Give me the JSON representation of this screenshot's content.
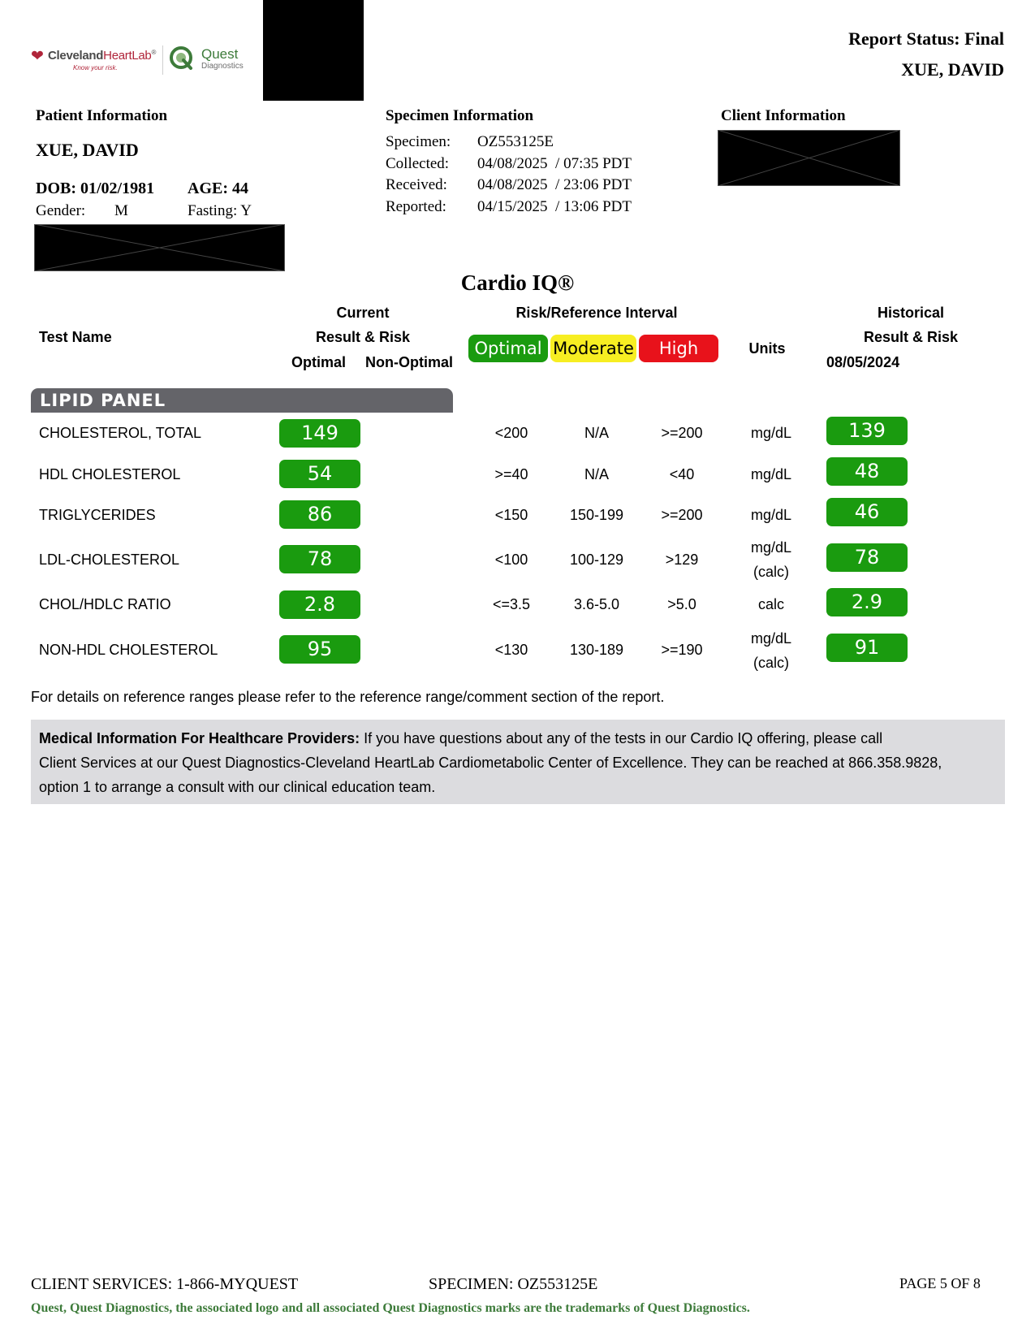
{
  "logo": {
    "cleveland_part1": "Cleveland",
    "cleveland_part2": "HeartLab",
    "cleveland_reg": "®",
    "cleveland_tagline": "Know your risk.",
    "quest_name": "Quest",
    "quest_sub": "Diagnostics"
  },
  "report_status": "Report Status: Final",
  "patient_name_header": "XUE, DAVID",
  "patient": {
    "heading": "Patient Information",
    "name": "XUE, DAVID",
    "dob": "DOB: 01/02/1981",
    "age": "AGE: 44",
    "gender_label": "Gender:",
    "gender_value": "M",
    "fasting": "Fasting: Y"
  },
  "specimen": {
    "heading": "Specimen Information",
    "rows": [
      {
        "label": "Specimen:",
        "value": "OZ553125E"
      },
      {
        "label": "Collected:",
        "value": "04/08/2025  / 07:35 PDT"
      },
      {
        "label": "Received:",
        "value": "04/08/2025  / 23:06 PDT"
      },
      {
        "label": "Reported:",
        "value": "04/15/2025  / 13:06 PDT"
      }
    ]
  },
  "client": {
    "heading": "Client Information"
  },
  "title": "Cardio IQ®",
  "headers": {
    "test_name": "Test Name",
    "current": "Current",
    "result_risk": "Result & Risk",
    "optimal": "Optimal",
    "non_optimal": "Non-Optimal",
    "risk_ref": "Risk/Reference Interval",
    "units": "Units",
    "historical": "Historical",
    "hist_result_risk": "Result & Risk",
    "hist_date": "08/05/2024"
  },
  "legend": [
    {
      "label": "Optimal",
      "color": "#1a9b0f",
      "text_color": "#ffffff"
    },
    {
      "label": "Moderate",
      "color": "#f7ee22",
      "text_color": "#000000"
    },
    {
      "label": "High",
      "color": "#e8121b",
      "text_color": "#ffffff"
    }
  ],
  "panel_name": "LIPID PANEL",
  "tests": [
    {
      "name": "CHOLESTEROL, TOTAL",
      "current": "149",
      "optimal": "<200",
      "moderate": "N/A",
      "high": ">=200",
      "units": "mg/dL",
      "units2": "",
      "historical": "139"
    },
    {
      "name": "HDL CHOLESTEROL",
      "current": "54",
      "optimal": ">=40",
      "moderate": "N/A",
      "high": "<40",
      "units": "mg/dL",
      "units2": "",
      "historical": "48"
    },
    {
      "name": "TRIGLYCERIDES",
      "current": "86",
      "optimal": "<150",
      "moderate": "150-199",
      "high": ">=200",
      "units": "mg/dL",
      "units2": "",
      "historical": "46"
    },
    {
      "name": "LDL-CHOLESTEROL",
      "current": "78",
      "optimal": "<100",
      "moderate": "100-129",
      "high": ">129",
      "units": "mg/dL",
      "units2": "(calc)",
      "historical": "78"
    },
    {
      "name": "CHOL/HDLC RATIO",
      "current": "2.8",
      "optimal": "<=3.5",
      "moderate": "3.6-5.0",
      "high": ">5.0",
      "units": "calc",
      "units2": "",
      "historical": "2.9"
    },
    {
      "name": "NON-HDL CHOLESTEROL",
      "current": "95",
      "optimal": "<130",
      "moderate": "130-189",
      "high": ">=190",
      "units": "mg/dL",
      "units2": "(calc)",
      "historical": "91"
    }
  ],
  "footnote": "For details on reference ranges please refer to the reference range/comment section of the report.",
  "medical_info": {
    "bold": "Medical Information For Healthcare Providers:",
    "line1": " If you have questions about any of the tests in our Cardio IQ offering, please call",
    "line2": "Client Services at our Quest Diagnostics-Cleveland HeartLab Cardiometabolic Center of Excellence. They can be reached at 866.358.9828,",
    "line3": "option 1 to arrange a consult with our clinical education team."
  },
  "footer": {
    "client_services": "CLIENT SERVICES: 1-866-MYQUEST",
    "specimen": "SPECIMEN: OZ553125E",
    "page": "PAGE 5 OF 8",
    "trademark": "Quest, Quest Diagnostics, the associated logo and all associated Quest Diagnostics marks are the trademarks of Quest Diagnostics."
  }
}
